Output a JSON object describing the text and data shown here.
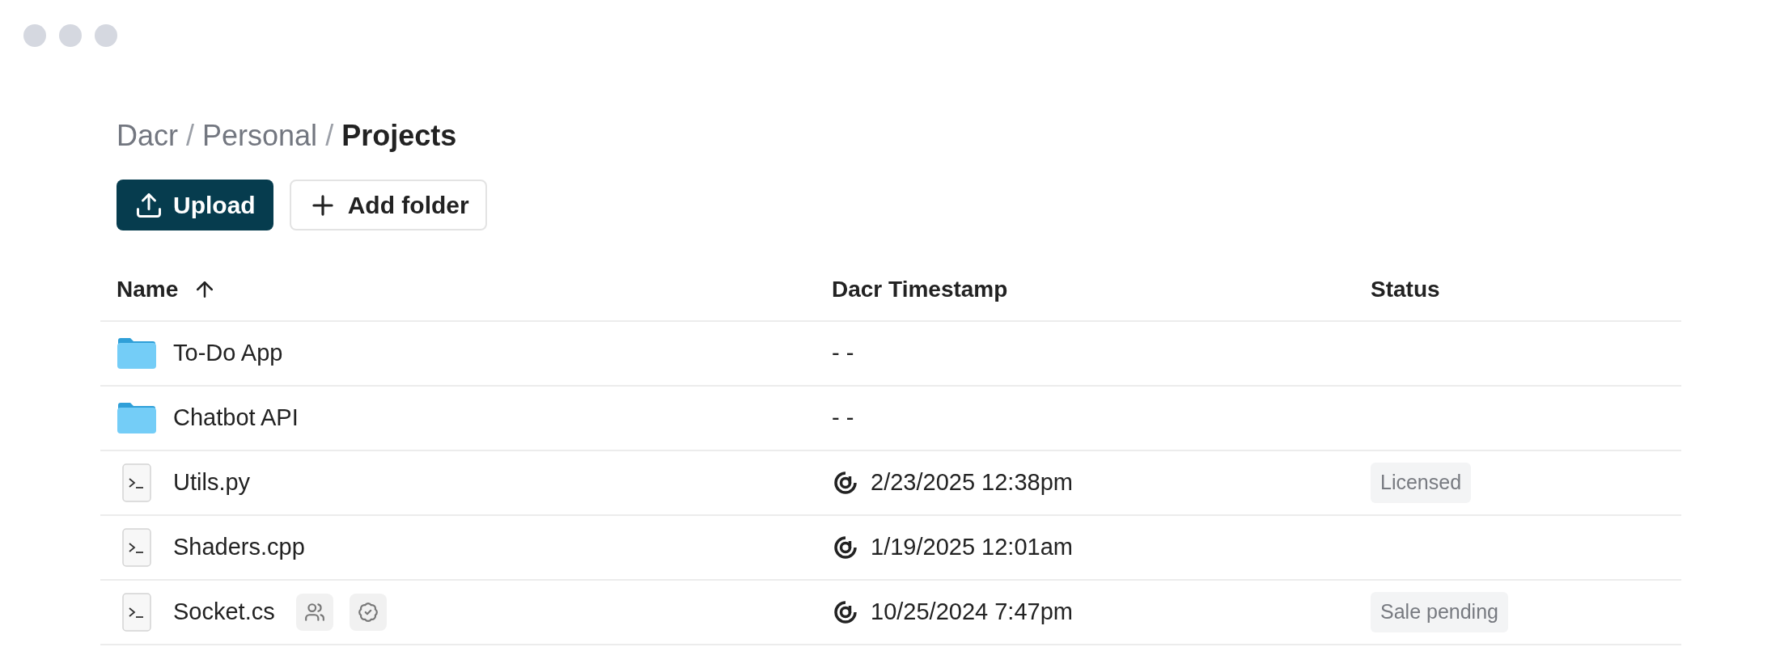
{
  "breadcrumb": {
    "separator": "/",
    "items": [
      {
        "label": "Dacr",
        "current": false
      },
      {
        "label": "Personal",
        "current": false
      },
      {
        "label": "Projects",
        "current": true
      }
    ]
  },
  "actions": [
    {
      "kind": "upload",
      "label": "Upload"
    },
    {
      "kind": "add",
      "label": "Add folder"
    }
  ],
  "table": {
    "columns": [
      {
        "label": "Name",
        "sorted": true
      },
      {
        "label": "Dacr Timestamp",
        "sorted": false
      },
      {
        "label": "Status",
        "sorted": false
      }
    ],
    "rows": [
      {
        "kind": "folder",
        "name": "To-Do App",
        "timestamp": "- -",
        "stamped": false,
        "shared": false,
        "verified": false
      },
      {
        "kind": "folder",
        "name": "Chatbot API",
        "timestamp": "- -",
        "stamped": false,
        "shared": false,
        "verified": false
      },
      {
        "kind": "file",
        "name": "Utils.py",
        "timestamp": "2/23/2025 12:38pm",
        "stamped": true,
        "status": "Licensed",
        "shared": false,
        "verified": false
      },
      {
        "kind": "file",
        "name": "Shaders.cpp",
        "timestamp": "1/19/2025 12:01am",
        "stamped": true,
        "shared": false,
        "verified": false
      },
      {
        "kind": "file",
        "name": "Socket.cs",
        "timestamp": "10/25/2024 7:47pm",
        "stamped": true,
        "status": "Sale pending",
        "shared": true,
        "verified": true
      }
    ]
  }
}
